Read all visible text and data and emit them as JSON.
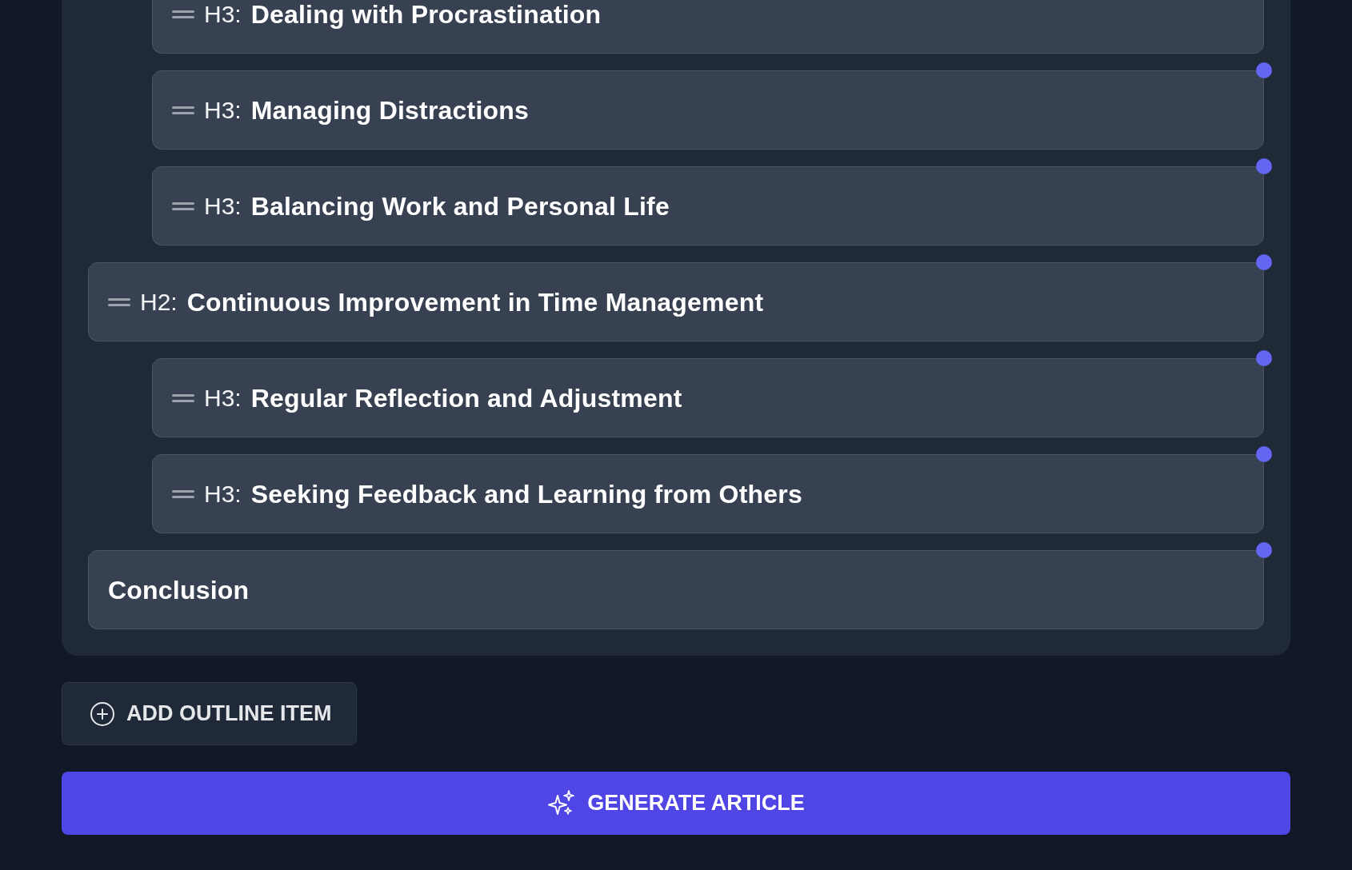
{
  "outline": {
    "continued_children": [
      {
        "kind": "heading",
        "level_label": "H3:",
        "title": "Dealing with Procrastination"
      },
      {
        "kind": "heading",
        "level_label": "H3:",
        "title": "Managing Distractions"
      },
      {
        "kind": "heading",
        "level_label": "H3:",
        "title": "Balancing Work and Personal Life"
      }
    ],
    "items": [
      {
        "kind": "heading",
        "level_label": "H2:",
        "title": "Continuous Improvement in Time Management",
        "children": [
          {
            "kind": "heading",
            "level_label": "H3:",
            "title": "Regular Reflection and Adjustment"
          },
          {
            "kind": "heading",
            "level_label": "H3:",
            "title": "Seeking Feedback and Learning from Others"
          }
        ]
      },
      {
        "kind": "section",
        "title": "Conclusion"
      }
    ]
  },
  "add_button": {
    "label": "ADD OUTLINE ITEM"
  },
  "generate_button": {
    "label": "GENERATE ARTICLE"
  }
}
